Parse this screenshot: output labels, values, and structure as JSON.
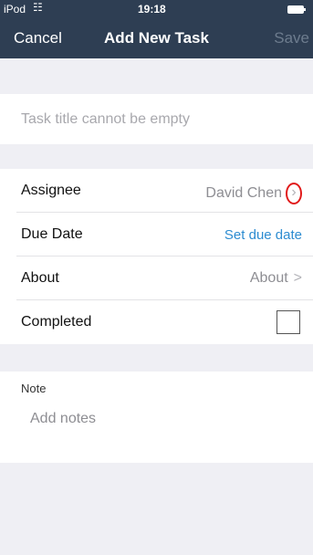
{
  "status_bar": {
    "carrier": "iPod",
    "time": "19:18"
  },
  "nav": {
    "cancel": "Cancel",
    "title": "Add New Task",
    "save": "Save"
  },
  "title_placeholder": "Task title cannot be empty",
  "rows": {
    "assignee": {
      "label": "Assignee",
      "value": "David Chen"
    },
    "due_date": {
      "label": "Due Date",
      "value": "Set due date"
    },
    "about": {
      "label": "About",
      "value": "About"
    },
    "completed": {
      "label": "Completed",
      "checked": false
    }
  },
  "note": {
    "label": "Note",
    "placeholder": "Add notes"
  },
  "colors": {
    "nav": "#2e3e53",
    "link": "#2d8cd1",
    "highlight": "#e11a1a"
  }
}
